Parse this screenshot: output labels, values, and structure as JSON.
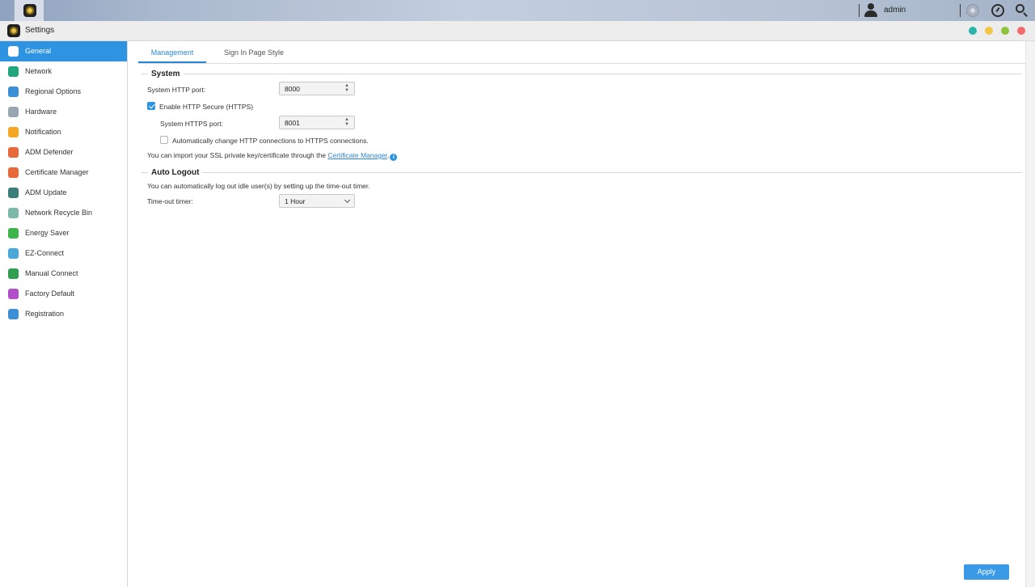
{
  "taskbar": {
    "user_name": "admin",
    "icons": [
      "settings-app-icon",
      "user-icon",
      "disc-icon",
      "gauge-icon",
      "search-icon"
    ]
  },
  "window": {
    "title": "Settings",
    "controls": [
      "#2bb5a9",
      "#f2c744",
      "#8dc33b",
      "#f26a6a"
    ]
  },
  "sidebar": {
    "active_index": 0,
    "items": [
      {
        "label": "General",
        "icon": "general-icon",
        "color": "#17b3a3"
      },
      {
        "label": "Network",
        "icon": "network-icon",
        "color": "#1fa67a"
      },
      {
        "label": "Regional Options",
        "icon": "regional-options-icon",
        "color": "#3a8fd6"
      },
      {
        "label": "Hardware",
        "icon": "hardware-icon",
        "color": "#9aa5b3"
      },
      {
        "label": "Notification",
        "icon": "notification-icon",
        "color": "#f5a623"
      },
      {
        "label": "ADM Defender",
        "icon": "adm-defender-icon",
        "color": "#e8693a"
      },
      {
        "label": "Certificate Manager",
        "icon": "certificate-manager-icon",
        "color": "#e8693a"
      },
      {
        "label": "ADM Update",
        "icon": "adm-update-icon",
        "color": "#3b7e7a"
      },
      {
        "label": "Network Recycle Bin",
        "icon": "recycle-bin-icon",
        "color": "#7cb9a8"
      },
      {
        "label": "Energy Saver",
        "icon": "energy-saver-icon",
        "color": "#3cb54a"
      },
      {
        "label": "EZ-Connect",
        "icon": "ez-connect-icon",
        "color": "#4aa8d8"
      },
      {
        "label": "Manual Connect",
        "icon": "manual-connect-icon",
        "color": "#2f9e4f"
      },
      {
        "label": "Factory Default",
        "icon": "factory-default-icon",
        "color": "#b04fc9"
      },
      {
        "label": "Registration",
        "icon": "registration-icon",
        "color": "#3a8fd6"
      }
    ]
  },
  "tabs": [
    {
      "label": "Management",
      "active": true
    },
    {
      "label": "Sign In Page Style",
      "active": false
    }
  ],
  "system": {
    "title": "System",
    "http_port_label": "System HTTP port:",
    "http_port_value": "8000",
    "https_enable_label": "Enable HTTP Secure (HTTPS)",
    "https_enabled": true,
    "https_port_label": "System HTTPS port:",
    "https_port_value": "8001",
    "auto_redirect_label": "Automatically change HTTP connections to HTTPS connections.",
    "auto_redirect_checked": false,
    "ssl_text_prefix": "You can import your SSL private key/certificate through the ",
    "ssl_link": "Certificate Manager",
    "ssl_text_suffix": "."
  },
  "auto_logout": {
    "title": "Auto Logout",
    "description": "You can automatically log out idle user(s) by setting up the time-out timer.",
    "timer_label": "Time-out timer:",
    "timer_value": "1 Hour"
  },
  "footer": {
    "apply_label": "Apply"
  }
}
